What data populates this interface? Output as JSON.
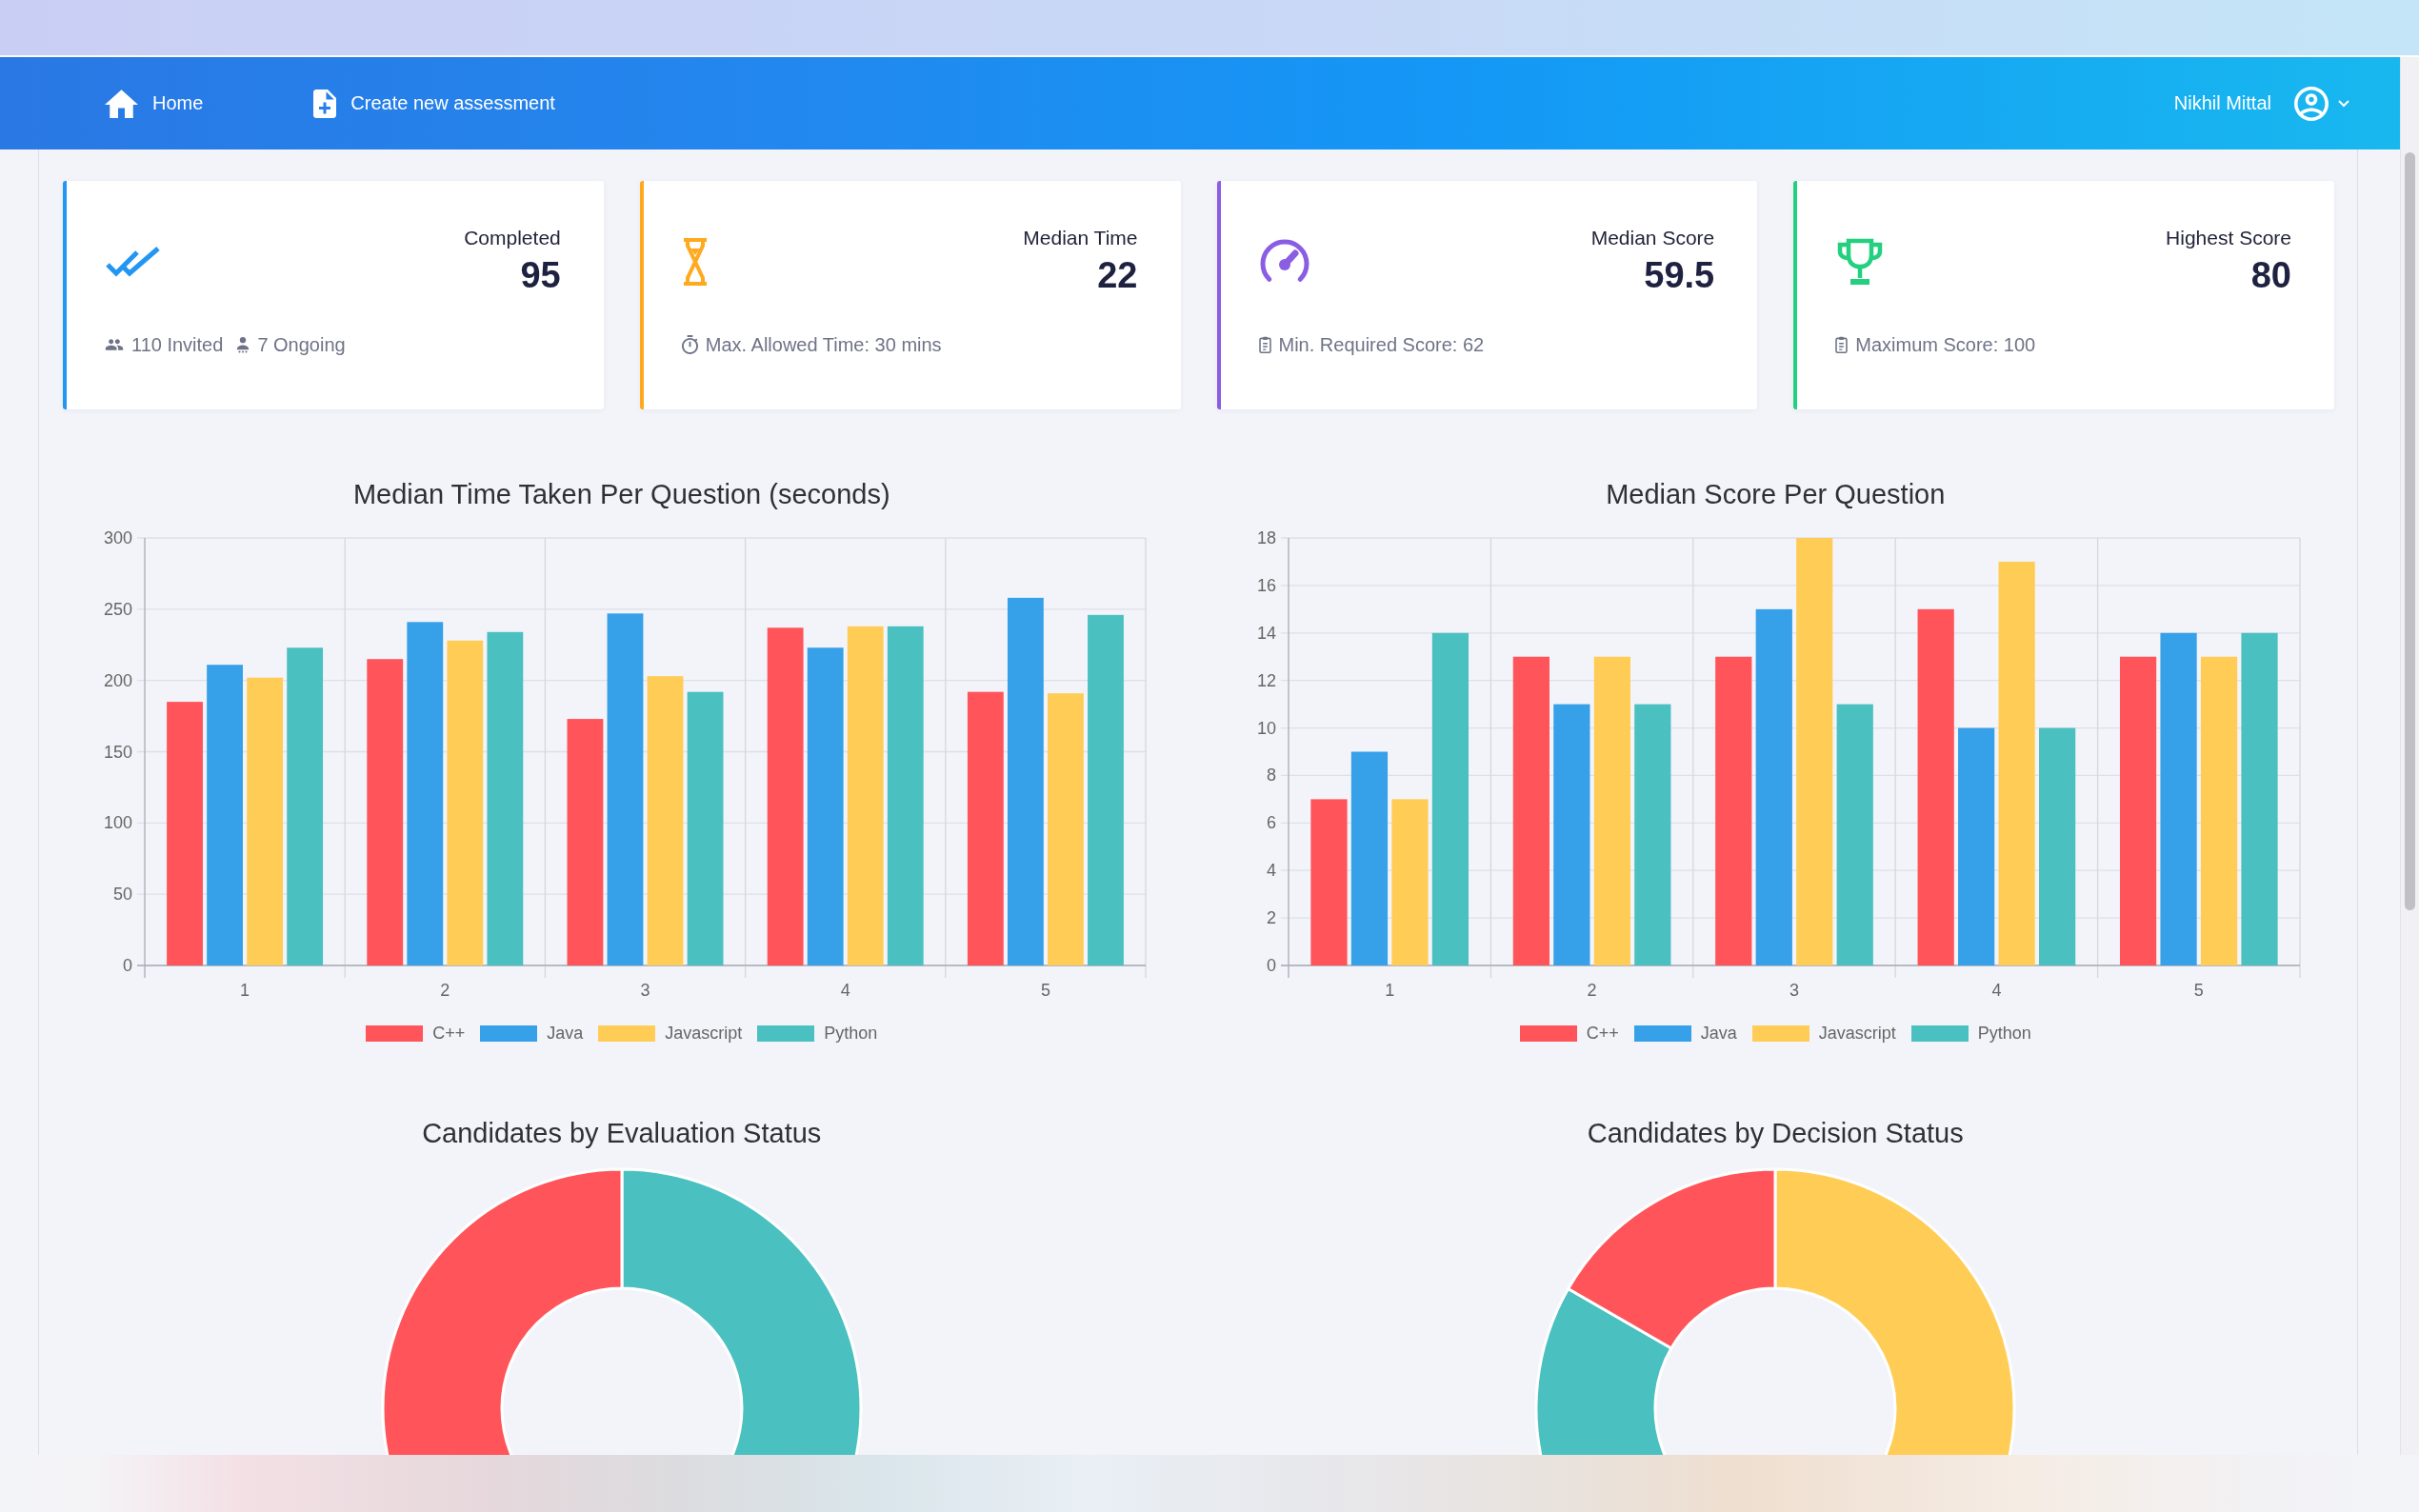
{
  "top_nav": {
    "links": [
      {
        "kind": "home",
        "label": "Home"
      },
      {
        "kind": "create",
        "label": "Create new assessment"
      }
    ],
    "user": {
      "name": "Nikhil Mittal"
    }
  },
  "stat_cards": [
    {
      "kind": "completed",
      "label": "Completed",
      "value": "95",
      "color": "#2196f3",
      "details": [
        {
          "kind": "group",
          "text": "110 Invited"
        },
        {
          "kind": "person",
          "text": "7 Ongoing"
        }
      ]
    },
    {
      "kind": "time",
      "label": "Median Time",
      "value": "22",
      "color": "#ffa91e",
      "details": [
        {
          "kind": "timer",
          "text": "Max. Allowed Time: 30 mins"
        }
      ]
    },
    {
      "kind": "score",
      "label": "Median Score",
      "value": "59.5",
      "color": "#8a5de3",
      "details": [
        {
          "kind": "clipboard",
          "text": "Min. Required Score: 62"
        }
      ]
    },
    {
      "kind": "trophy",
      "label": "Highest Score",
      "value": "80",
      "color": "#22d07f",
      "details": [
        {
          "kind": "clipboard",
          "text": "Maximum Score: 100"
        }
      ]
    }
  ],
  "bar_charts": [
    {
      "chart_data": {
        "type": "bar",
        "title": "Median Time Taken Per Question (seconds)",
        "categories": [
          "1",
          "2",
          "3",
          "4",
          "5"
        ],
        "series": [
          {
            "name": "C++",
            "color": "#ff5459",
            "values": [
              185,
              215,
              173,
              237,
              192
            ]
          },
          {
            "name": "Java",
            "color": "#36a0e8",
            "values": [
              211,
              241,
              247,
              223,
              258
            ]
          },
          {
            "name": "Javascript",
            "color": "#ffcd56",
            "values": [
              202,
              228,
              203,
              238,
              191
            ]
          },
          {
            "name": "Python",
            "color": "#4bc0c0",
            "values": [
              223,
              234,
              192,
              238,
              246
            ]
          }
        ],
        "ylim": [
          0,
          300
        ],
        "yticks": [
          0,
          50,
          100,
          150,
          200,
          250,
          300
        ],
        "grid": true,
        "legend": "bottom"
      }
    },
    {
      "chart_data": {
        "type": "bar",
        "title": "Median Score Per Question",
        "categories": [
          "1",
          "2",
          "3",
          "4",
          "5"
        ],
        "series": [
          {
            "name": "C++",
            "color": "#ff5459",
            "values": [
              7,
              13,
              13,
              15,
              13
            ]
          },
          {
            "name": "Java",
            "color": "#36a0e8",
            "values": [
              9,
              11,
              15,
              10,
              14
            ]
          },
          {
            "name": "Javascript",
            "color": "#ffcd56",
            "values": [
              7,
              13,
              18,
              17,
              13
            ]
          },
          {
            "name": "Python",
            "color": "#4bc0c0",
            "values": [
              14,
              11,
              11,
              10,
              14
            ]
          }
        ],
        "ylim": [
          0,
          18
        ],
        "yticks": [
          0,
          2,
          4,
          6,
          8,
          10,
          12,
          14,
          16,
          18
        ],
        "grid": true,
        "legend": "bottom"
      }
    }
  ],
  "donut_charts": [
    {
      "title": "Candidates by Evaluation Status"
    },
    {
      "title": "Candidates by Decision Status"
    }
  ]
}
